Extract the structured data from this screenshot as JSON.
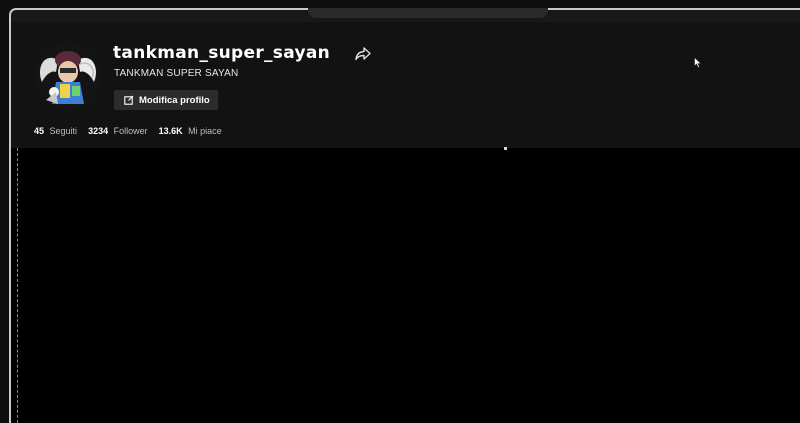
{
  "profile": {
    "username": "tankman_super_sayan",
    "display_name": "TANKMAN SUPER SAYAN",
    "edit_button": "Modifica profilo",
    "share_icon": "share-arrow-icon",
    "edit_icon": "edit-square-icon"
  },
  "stats": [
    {
      "value": "45",
      "label": "Seguiti"
    },
    {
      "value": "3234",
      "label": "Follower"
    },
    {
      "value": "13.6K",
      "label": "Mi piace"
    }
  ],
  "colors": {
    "background": "#121212",
    "content_area": "#000000",
    "button_bg": "#2c2c2c",
    "text": "#ffffff"
  }
}
